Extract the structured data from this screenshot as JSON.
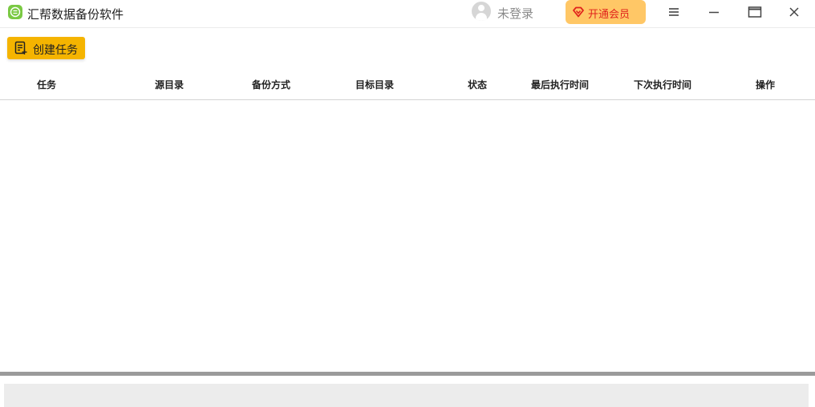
{
  "app": {
    "title": "汇帮数据备份软件"
  },
  "user": {
    "login_label": "未登录"
  },
  "vip": {
    "label": "开通会员"
  },
  "toolbar": {
    "create_label": "创建任务"
  },
  "table": {
    "columns": [
      "任务",
      "源目录",
      "备份方式",
      "目标目录",
      "状态",
      "最后执行时间",
      "下次执行时间",
      "操作"
    ],
    "rows": []
  },
  "colors": {
    "accent": "#f5b400",
    "vip_bg": "#ffc766",
    "vip_text": "#e0231c",
    "logo": "#7ac943"
  }
}
